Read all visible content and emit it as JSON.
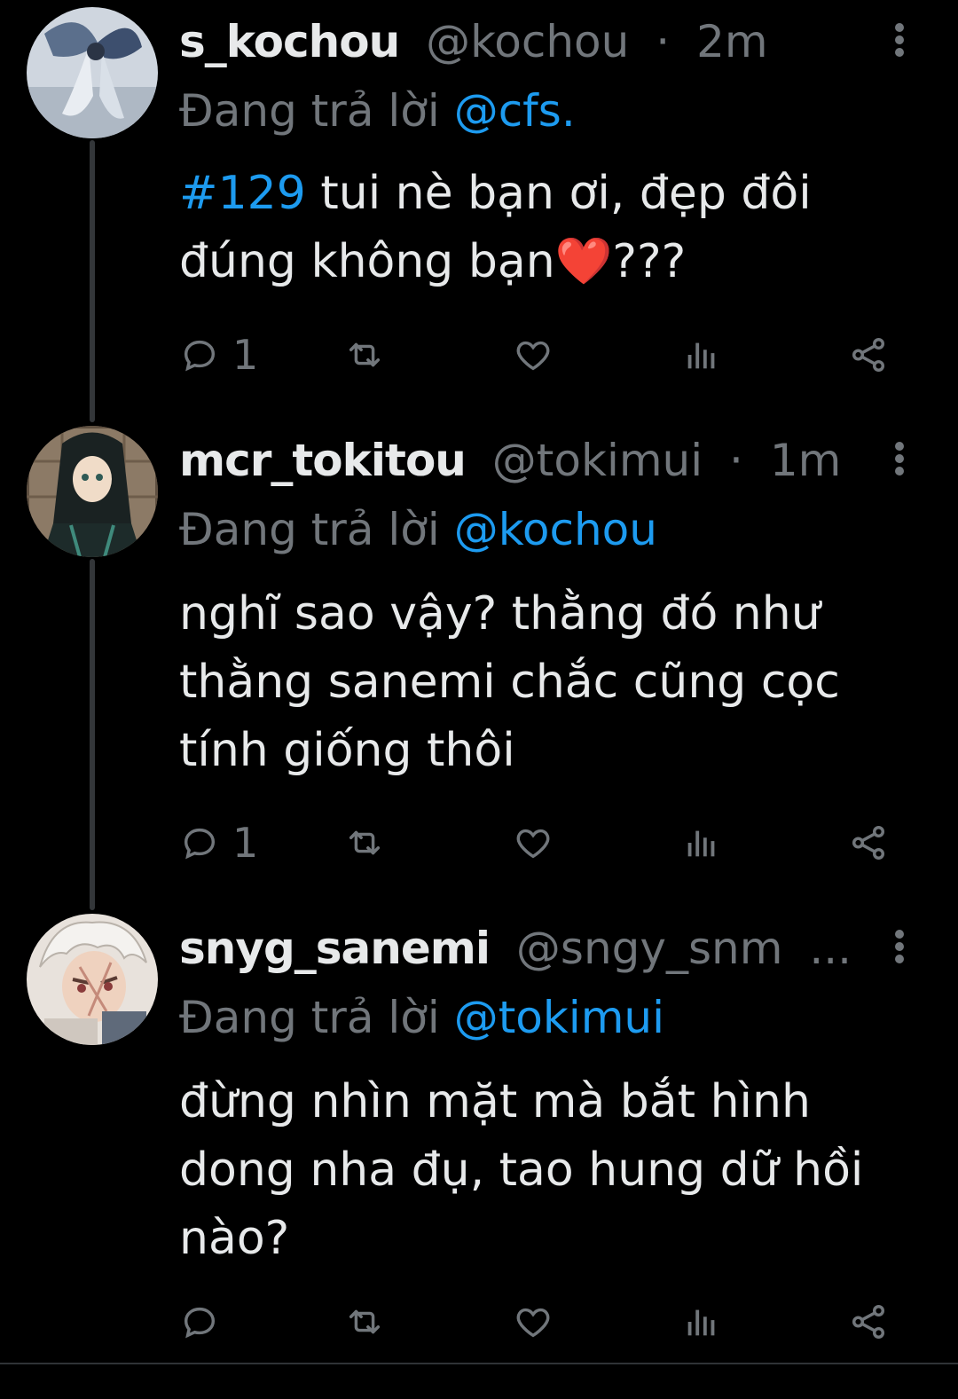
{
  "tweets": [
    {
      "display_name": "s_kochou",
      "handle": "@kochou",
      "separator": "·",
      "time": "2m",
      "reply_prefix": "Đang trả lời",
      "reply_to": "@cfs.",
      "hashtag": "#129",
      "text_line1": " tui nè bạn ơi, đẹp đôi",
      "text_line2": "đúng không bạn❤️???",
      "reply_count": "1",
      "avatar_icon": "butterfly-avatar"
    },
    {
      "display_name": "mcr_tokitou",
      "handle": "@tokimui",
      "separator": "·",
      "time": "1m",
      "reply_prefix": "Đang trả lời",
      "reply_to": "@kochou",
      "text_line1": "nghĩ sao vậy? thằng đó như",
      "text_line2": "thằng sanemi chắc cũng cọc",
      "text_line3": "tính giống thôi",
      "reply_count": "1",
      "avatar_icon": "dark-hair-avatar"
    },
    {
      "display_name": "snyg_sanemi",
      "handle": "@sngy_snm",
      "ellipsis": "...",
      "reply_prefix": "Đang trả lời",
      "reply_to": "@tokimui",
      "text_line1": "đừng nhìn mặt mà bắt hình",
      "text_line2": "dong nha đụ, tao hung dữ hồi",
      "text_line3": "nào?",
      "reply_count": "",
      "avatar_icon": "white-hair-avatar"
    }
  ],
  "colors": {
    "background": "#000000",
    "text_primary": "#e7e9ea",
    "text_secondary": "#71767b",
    "accent": "#1d9bf0",
    "thread_line": "#333639"
  },
  "icons": {
    "reply": "reply-icon",
    "retweet": "retweet-icon",
    "like": "heart-icon",
    "views": "views-icon",
    "share": "share-icon",
    "more": "more-vertical-icon"
  }
}
